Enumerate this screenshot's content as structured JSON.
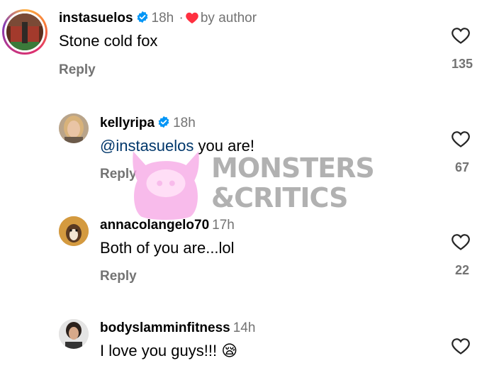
{
  "comments": [
    {
      "username": "instasuelos",
      "time": "18h",
      "separator": "·",
      "author_label": "by author",
      "text": "Stone cold fox",
      "reply_label": "Reply",
      "likes": "135"
    },
    {
      "username": "kellyripa",
      "time": "18h",
      "mention": "@instasuelos",
      "text": " you are!",
      "reply_label": "Reply",
      "likes": "67"
    },
    {
      "username": "annacolangelo70",
      "time": "17h",
      "text": "Both of you are...lol",
      "reply_label": "Reply",
      "likes": "22"
    },
    {
      "username": "bodyslamminfitness",
      "time": "14h",
      "text": "I love you guys!!!",
      "emoji": "😪"
    }
  ],
  "watermark": {
    "line1": "MONSTERS",
    "line2": "&CRITICS"
  },
  "colors": {
    "verified": "#0095f6",
    "author_heart": "#ff3040",
    "mention": "#00376b",
    "secondary_text": "#737373",
    "watermark_pink": "#f7a8e6"
  },
  "icons": {
    "verified": "verified-badge-icon",
    "author_like": "heart-filled-icon",
    "like": "heart-outline-icon"
  }
}
